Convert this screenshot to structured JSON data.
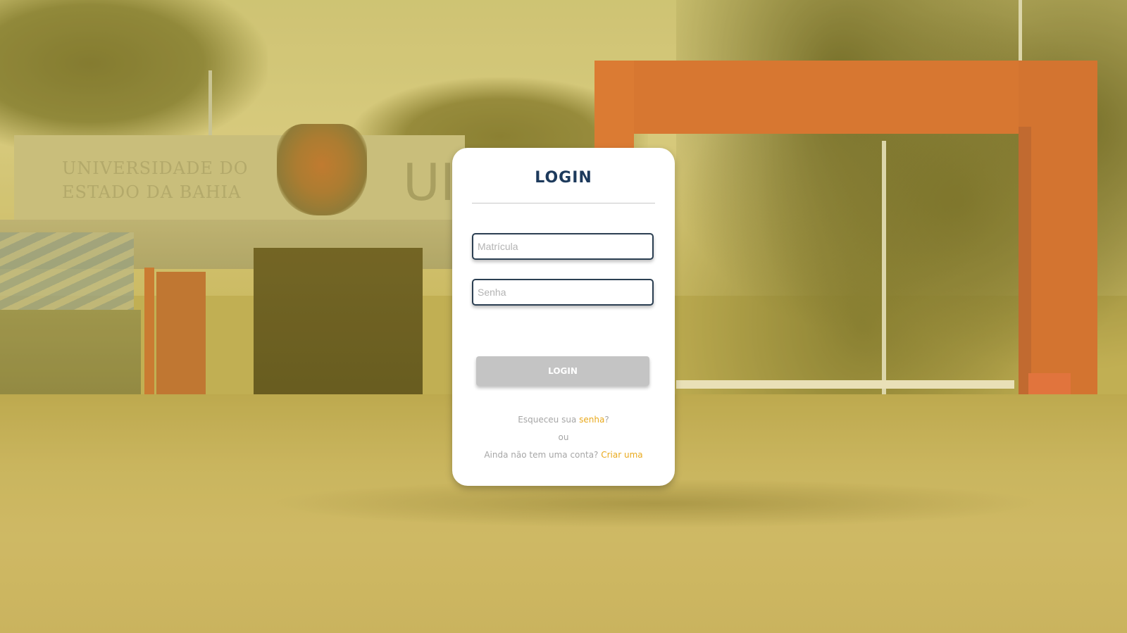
{
  "background": {
    "building_lettering_line1": "UNIVERSIDADE DO",
    "building_lettering_line2": "ESTADO DA BAHIA",
    "building_big_letter": "UI",
    "overlay_color": "#e8cd50"
  },
  "login_card": {
    "title": "LOGIN",
    "matricula_placeholder": "Matrícula",
    "senha_placeholder": "Senha",
    "login_button_label": "LOGIN",
    "forgot_prefix": "Esqueceu sua ",
    "forgot_link": "senha",
    "forgot_suffix": "?",
    "or_text": "ou",
    "signup_prefix": "Ainda não tem uma conta? ",
    "signup_link": "Criar uma",
    "colors": {
      "title": "#1d3a5c",
      "accent_link": "#e9a91c",
      "button_bg": "#c4c4c4",
      "field_border": "#2b3f52"
    }
  }
}
